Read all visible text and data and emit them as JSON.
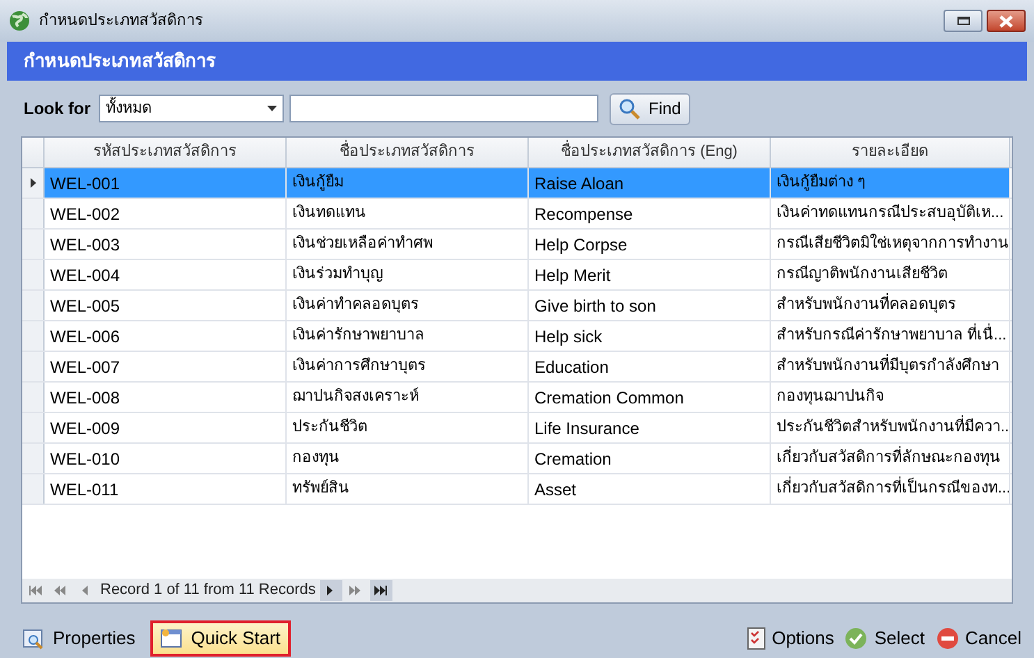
{
  "window": {
    "title": "กำหนดประเภทสวัสดิการ"
  },
  "header": {
    "title": "กำหนดประเภทสวัสดิการ"
  },
  "search": {
    "label": "Look for",
    "scope": "ทั้งหมด",
    "button": "Find"
  },
  "table": {
    "columns": [
      "รหัสประเภทสวัสดิการ",
      "ชื่อประเภทสวัสดิการ",
      "ชื่อประเภทสวัสดิการ (Eng)",
      "รายละเอียด"
    ],
    "rows": [
      {
        "selected": true,
        "cells": [
          "WEL-001",
          "เงินกู้ยืม",
          "Raise Aloan",
          "เงินกู้ยืมต่าง ๆ"
        ]
      },
      {
        "selected": false,
        "cells": [
          "WEL-002",
          "เงินทดแทน",
          "Recompense",
          "เงินค่าทดแทนกรณีประสบอุบัติเห..."
        ]
      },
      {
        "selected": false,
        "cells": [
          "WEL-003",
          "เงินช่วยเหลือค่าทำศพ",
          "Help Corpse",
          "กรณีเสียชีวิตมิใช่เหตุจากการทำงาน"
        ]
      },
      {
        "selected": false,
        "cells": [
          "WEL-004",
          "เงินร่วมทำบุญ",
          "Help Merit",
          "กรณีญาติพนักงานเสียชีวิต"
        ]
      },
      {
        "selected": false,
        "cells": [
          "WEL-005",
          "เงินค่าทำคลอดบุตร",
          "Give birth to son",
          "สำหรับพนักงานที่คลอดบุตร"
        ]
      },
      {
        "selected": false,
        "cells": [
          "WEL-006",
          "เงินค่ารักษาพยาบาล",
          "Help sick",
          "สำหรับกรณีค่ารักษาพยาบาล ที่เนื่..."
        ]
      },
      {
        "selected": false,
        "cells": [
          "WEL-007",
          "เงินค่าการศึกษาบุตร",
          "Education",
          "สำหรับพนักงานที่มีบุตรกำลังศึกษา"
        ]
      },
      {
        "selected": false,
        "cells": [
          "WEL-008",
          "ฌาปนกิจสงเคราะห์",
          "Cremation Common",
          "กองทุนฌาปนกิจ"
        ]
      },
      {
        "selected": false,
        "cells": [
          "WEL-009",
          "ประกันชีวิต",
          "Life Insurance",
          "ประกันชีวิตสำหรับพนักงานที่มีควา..."
        ]
      },
      {
        "selected": false,
        "cells": [
          "WEL-010",
          "กองทุน",
          "Cremation",
          "เกี่ยวกับสวัสดิการที่ลักษณะกองทุน"
        ]
      },
      {
        "selected": false,
        "cells": [
          "WEL-011",
          "ทรัพย์สิน",
          "Asset",
          "เกี่ยวกับสวัสดิการที่เป็นกรณีของท..."
        ]
      }
    ]
  },
  "navigator": {
    "text": "Record 1 of 11 from 11 Records"
  },
  "footer": {
    "left": [
      {
        "label": "Properties",
        "highlighted": false
      },
      {
        "label": "Quick Start",
        "highlighted": true
      }
    ],
    "right": [
      {
        "label": "Options",
        "kind": "options"
      },
      {
        "label": "Select",
        "kind": "select"
      },
      {
        "label": "Cancel",
        "kind": "cancel"
      }
    ]
  }
}
